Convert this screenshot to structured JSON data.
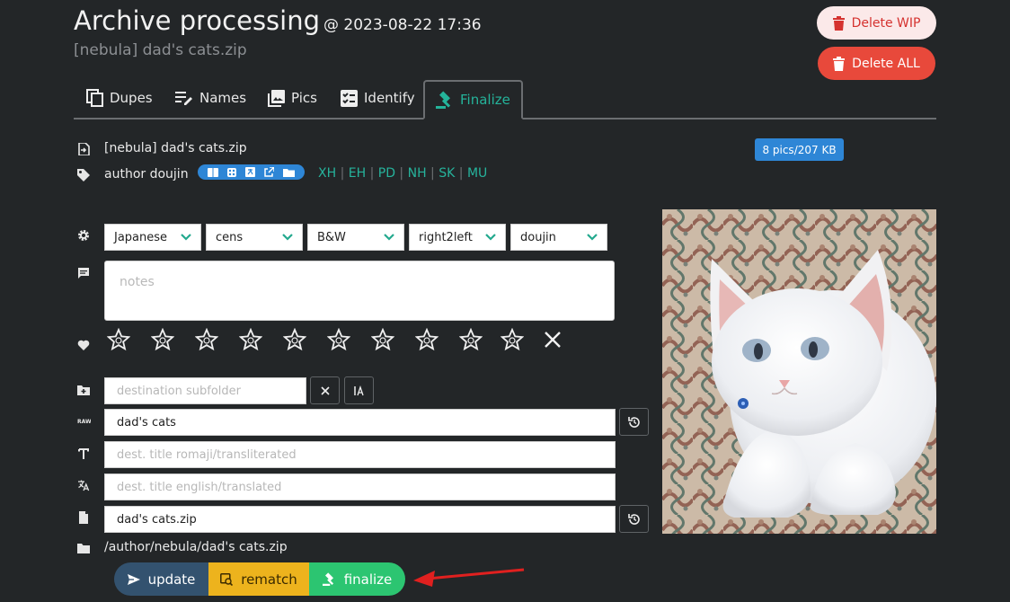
{
  "header": {
    "title": "Archive processing",
    "timestamp": "@ 2023-08-22 17:36",
    "subtitle": "[nebula] dad's cats.zip",
    "delete_wip": "Delete WIP",
    "delete_all": "Delete ALL"
  },
  "tabs": [
    {
      "label": "Dupes",
      "icon": "copy-icon"
    },
    {
      "label": "Names",
      "icon": "edit-list-icon"
    },
    {
      "label": "Pics",
      "icon": "images-icon"
    },
    {
      "label": "Identify",
      "icon": "checklist-icon"
    },
    {
      "label": "Finalize",
      "icon": "gavel-icon",
      "active": true
    }
  ],
  "info": {
    "filename": "[nebula] dad's cats.zip",
    "tags": "author doujin",
    "badge": "8 pics/207 KB",
    "links": [
      "XH",
      "EH",
      "PD",
      "NH",
      "SK",
      "MU"
    ]
  },
  "selects": [
    "Japanese",
    "cens",
    "B&W",
    "right2left",
    "doujin"
  ],
  "notes_placeholder": "notes",
  "fields": {
    "subfolder_placeholder": "destination subfolder",
    "raw_title": "dad's cats",
    "romaji_placeholder": "dest. title romaji/transliterated",
    "english_placeholder": "dest. title english/translated",
    "filename": "dad's cats.zip",
    "dest_path": "/author/nebula/dad's cats.zip"
  },
  "actions": {
    "update": "update",
    "rematch": "rematch",
    "finalize": "finalize"
  },
  "colors": {
    "accent": "#24b39a",
    "update": "#33526f",
    "rematch": "#edb31d",
    "finalize": "#2cc571",
    "delete": "#e8493b",
    "badge": "#2e86d6"
  },
  "rating": {
    "stars": 10,
    "value": 0
  }
}
